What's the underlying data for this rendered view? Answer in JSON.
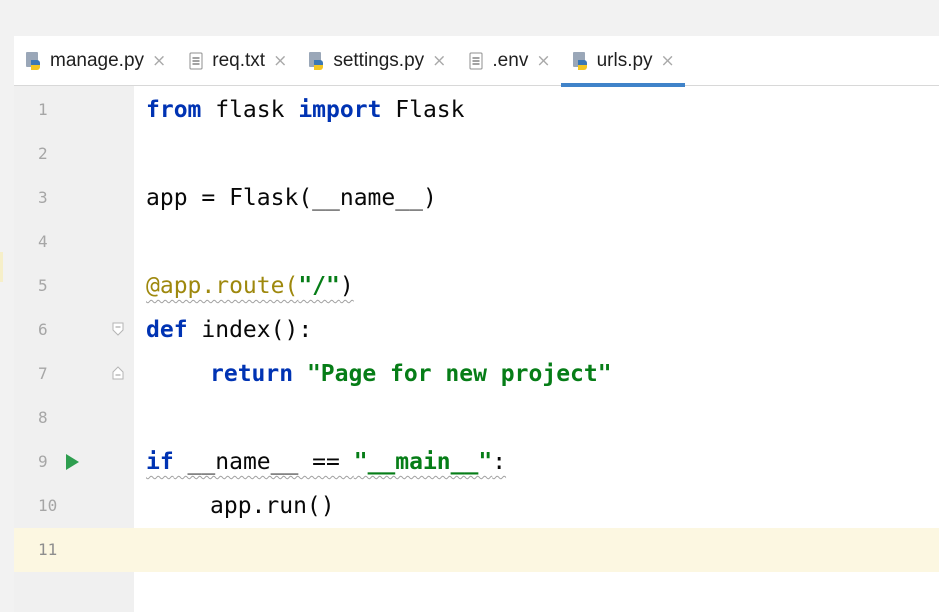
{
  "tabs": [
    {
      "label": "manage.py",
      "icon": "python-file-icon",
      "active": false
    },
    {
      "label": "req.txt",
      "icon": "text-file-icon",
      "active": false
    },
    {
      "label": "settings.py",
      "icon": "python-file-icon",
      "active": false
    },
    {
      "label": ".env",
      "icon": "text-file-icon",
      "active": false
    },
    {
      "label": "urls.py",
      "icon": "python-file-icon",
      "active": true
    }
  ],
  "close_glyph": "×",
  "line_numbers": [
    "1",
    "2",
    "3",
    "4",
    "5",
    "6",
    "7",
    "8",
    "9",
    "10",
    "11"
  ],
  "code": {
    "l1_from": "from",
    "l1_mod": " flask ",
    "l1_import": "import",
    "l1_name": " Flask",
    "l3": "app = Flask(__name__)",
    "l5_deco": "@app.route(",
    "l5_str": "\"/\"",
    "l5_end": ")",
    "l6_def": "def",
    "l6_rest": " index():",
    "l7_return": "return",
    "l7_str": " \"Page for new project\"",
    "l9_if": "if",
    "l9_mid": " __name__ == ",
    "l9_str": "\"__main__\"",
    "l9_end": ":",
    "l10": "app.run()"
  },
  "colors": {
    "keyword": "#0033b3",
    "string": "#067d17",
    "decorator": "#9e880d",
    "run_icon": "#2e9e4f",
    "active_tab_underline": "#4083c9",
    "current_line": "#fcf7e1"
  }
}
